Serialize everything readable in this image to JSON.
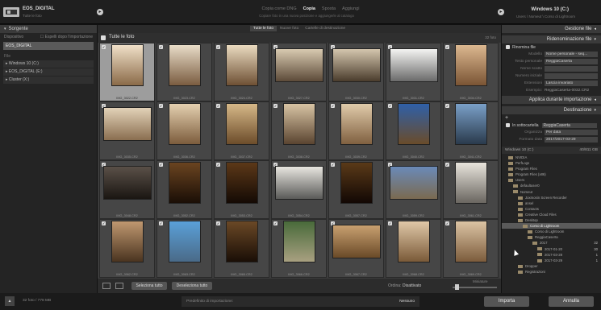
{
  "topbar": {
    "source_id": "EOS_DIGITAL",
    "source_sub": "Tutte le foto",
    "modes": [
      {
        "label": "Copia come DNG",
        "active": false
      },
      {
        "label": "Copia",
        "active": true
      },
      {
        "label": "Sposta",
        "active": false
      },
      {
        "label": "Aggiungi",
        "active": false
      }
    ],
    "modes_sub": "Copiare foto in una nuova posizione e aggiungerle al catalogo",
    "dest_id": "Windows 10 (C:)",
    "dest_sub": "Users \\ Nomeut \\ Corso di Lightroom"
  },
  "left": {
    "title": "Sorgente",
    "device_label": "Dispositivo",
    "eject_label": "Espelli dopo l'importazione",
    "selected_device": "EOS_DIGITAL",
    "files_label": "File",
    "drives": [
      "Windows 10 (C:)",
      "EOS_DIGITAL (E:)",
      "Cluster (X:)"
    ]
  },
  "center": {
    "tabs": [
      {
        "label": "Tutte le foto",
        "active": true
      },
      {
        "label": "Nuove foto",
        "active": false
      },
      {
        "label": "Cartelle di destinazione",
        "active": false
      }
    ],
    "header_label": "Tutte le foto",
    "count_label": "32 foto",
    "photos": [
      {
        "name": "IMG_3022.CR2",
        "orient": "port",
        "colors": [
          "#f0e0c8",
          "#8a6a48"
        ],
        "selected": true
      },
      {
        "name": "IMG_3023.CR2",
        "orient": "port",
        "colors": [
          "#e8dcc8",
          "#7a5c40"
        ],
        "selected": false
      },
      {
        "name": "IMG_3024.CR2",
        "orient": "port",
        "colors": [
          "#eadbc0",
          "#6e5034"
        ],
        "selected": false
      },
      {
        "name": "IMG_3027.CR2",
        "orient": "land",
        "colors": [
          "#d8cab0",
          "#5c4a38"
        ],
        "selected": false
      },
      {
        "name": "IMG_3030.CR2",
        "orient": "land",
        "colors": [
          "#d4c6ae",
          "#4a3c2c"
        ],
        "selected": false
      },
      {
        "name": "IMG_3031.CR2",
        "orient": "land",
        "colors": [
          "#f4f4f2",
          "#6a6a6a"
        ],
        "selected": false
      },
      {
        "name": "IMG_3034.CR2",
        "orient": "port",
        "colors": [
          "#dcb890",
          "#7a5434"
        ],
        "selected": false
      },
      {
        "name": "IMG_3035.CR2",
        "orient": "land",
        "colors": [
          "#e2d2b8",
          "#8a6e50"
        ],
        "selected": false
      },
      {
        "name": "IMG_3036.CR2",
        "orient": "port",
        "colors": [
          "#e4d0b0",
          "#7c5c3c"
        ],
        "selected": false
      },
      {
        "name": "IMG_3037.CR2",
        "orient": "port",
        "colors": [
          "#d6b888",
          "#6c4c2a"
        ],
        "selected": false
      },
      {
        "name": "IMG_3038.CR2",
        "orient": "port",
        "colors": [
          "#d8c4a4",
          "#5a4430"
        ],
        "selected": false
      },
      {
        "name": "IMG_3039.CR2",
        "orient": "port",
        "colors": [
          "#e0cbaa",
          "#806040"
        ],
        "selected": false
      },
      {
        "name": "IMG_3040.CR2",
        "orient": "port",
        "colors": [
          "#2f60a8",
          "#6a4c2a"
        ],
        "selected": false
      },
      {
        "name": "IMG_3041.CR2",
        "orient": "port",
        "colors": [
          "#7aa0c8",
          "#2a3a4c"
        ],
        "selected": false
      },
      {
        "name": "IMG_3048.CR2",
        "orient": "land",
        "colors": [
          "#5a5048",
          "#1a1612"
        ],
        "selected": false
      },
      {
        "name": "IMG_3052.CR2",
        "orient": "port",
        "colors": [
          "#6a4420",
          "#1a0e06"
        ],
        "selected": false
      },
      {
        "name": "IMG_3053.CR2",
        "orient": "port",
        "colors": [
          "#5c3818",
          "#140a04"
        ],
        "selected": false
      },
      {
        "name": "IMG_3054.CR2",
        "orient": "land",
        "colors": [
          "#e8e6e0",
          "#5a5a58"
        ],
        "selected": false
      },
      {
        "name": "IMG_3057.CR2",
        "orient": "port",
        "colors": [
          "#5a3a18",
          "#120804"
        ],
        "selected": false
      },
      {
        "name": "IMG_3059.CR2",
        "orient": "land",
        "colors": [
          "#6a8ab8",
          "#7a6a50"
        ],
        "selected": false
      },
      {
        "name": "IMG_3061.CR2",
        "orient": "port",
        "colors": [
          "#e8e4dc",
          "#6a6660"
        ],
        "selected": false
      },
      {
        "name": "IMG_3062.CR2",
        "orient": "port",
        "colors": [
          "#c09870",
          "#4a3420"
        ],
        "selected": false
      },
      {
        "name": "IMG_3063.CR2",
        "orient": "port",
        "colors": [
          "#5aa0d8",
          "#4a6a88"
        ],
        "selected": false
      },
      {
        "name": "IMG_3065.CR2",
        "orient": "port",
        "colors": [
          "#6a4826",
          "#1a0e06"
        ],
        "selected": false
      },
      {
        "name": "IMG_3066.CR2",
        "orient": "port",
        "colors": [
          "#486a3a",
          "#a8a080"
        ],
        "selected": false
      },
      {
        "name": "IMG_3067.CR2",
        "orient": "land",
        "colors": [
          "#c8a070",
          "#6a4a28"
        ],
        "selected": false
      },
      {
        "name": "IMG_3068.CR2",
        "orient": "port",
        "colors": [
          "#e0c8a8",
          "#7a5a38"
        ],
        "selected": false
      },
      {
        "name": "IMG_3069.CR2",
        "orient": "port",
        "colors": [
          "#dcc4a4",
          "#7c5c3c"
        ],
        "selected": false
      }
    ],
    "toolbar": {
      "select_all": "Seleziona tutto",
      "deselect_all": "Deseleziona tutto",
      "sort_label": "Ordina:",
      "sort_value": "Disattivato",
      "thumb_label": "Miniature"
    }
  },
  "right": {
    "file_handling": "Gestione file",
    "rename": "Ridenominazione file",
    "rename_check": "Rinomina file",
    "rename_rows": [
      {
        "label": "Modello",
        "value": "Nome personale - seq..."
      },
      {
        "label": "Testo personale",
        "value": "ReggiaCaserta"
      },
      {
        "label": "Nome scatto",
        "value": ""
      },
      {
        "label": "Numero iniziale",
        "value": ""
      },
      {
        "label": "Estensioni",
        "value": "Lascia invariato"
      }
    ],
    "example_label": "Esempio:",
    "example_value": "ReggiaCaserta-0032.CR2",
    "apply_during": "Applica durante importazione",
    "destination": "Destinazione",
    "subfolder_label": "In sottocartella",
    "subfolder_value": "ReggiaCaserta",
    "organize_label": "Organizza",
    "organize_value": "Per data",
    "format_label": "Formato data",
    "format_value": "2017/2017-03-29",
    "volume_name": "Windows 10 (C:)",
    "volume_free": "40/811 GB",
    "tree": [
      {
        "label": "NVIDIA",
        "indent": 0,
        "count": "",
        "sel": false
      },
      {
        "label": "PerfLogs",
        "indent": 0,
        "count": "",
        "sel": false
      },
      {
        "label": "Program Files",
        "indent": 0,
        "count": "",
        "sel": false
      },
      {
        "label": "Program Files (x86)",
        "indent": 0,
        "count": "",
        "sel": false
      },
      {
        "label": "Users",
        "indent": 0,
        "count": "",
        "sel": false
      },
      {
        "label": "defaultuser0",
        "indent": 1,
        "count": "",
        "sel": false
      },
      {
        "label": "Nomeut",
        "indent": 1,
        "count": "",
        "sel": false
      },
      {
        "label": "Joxmosin Screen Recorder",
        "indent": 2,
        "count": "",
        "sel": false
      },
      {
        "label": "ansel",
        "indent": 2,
        "count": "",
        "sel": false
      },
      {
        "label": "Contacts",
        "indent": 2,
        "count": "",
        "sel": false
      },
      {
        "label": "Creative Cloud Files",
        "indent": 2,
        "count": "",
        "sel": false
      },
      {
        "label": "Desktop",
        "indent": 2,
        "count": "",
        "sel": false
      },
      {
        "label": "Corso di Lightroom",
        "indent": 3,
        "count": "",
        "sel": true
      },
      {
        "label": "Corso di Lightroom",
        "indent": 4,
        "count": "",
        "sel": false
      },
      {
        "label": "ReggiaCaserta",
        "indent": 4,
        "count": "",
        "sel": false
      },
      {
        "label": "2017",
        "indent": 5,
        "count": "32",
        "sel": false
      },
      {
        "label": "2017-01-20",
        "indent": 6,
        "count": "30",
        "sel": false
      },
      {
        "label": "2017-03-28",
        "indent": 6,
        "count": "1",
        "sel": false
      },
      {
        "label": "2017-03-29",
        "indent": 6,
        "count": "1",
        "sel": false
      },
      {
        "label": "Dropper",
        "indent": 2,
        "count": "",
        "sel": false
      },
      {
        "label": "Registrazioni",
        "indent": 2,
        "count": "",
        "sel": false
      }
    ]
  },
  "bottom": {
    "count": "32 foto / 778 MB",
    "preset_label": "Predefinito di importazione:",
    "preset_value": "Nessuno",
    "import_label": "Importa",
    "cancel_label": "Annulla"
  }
}
